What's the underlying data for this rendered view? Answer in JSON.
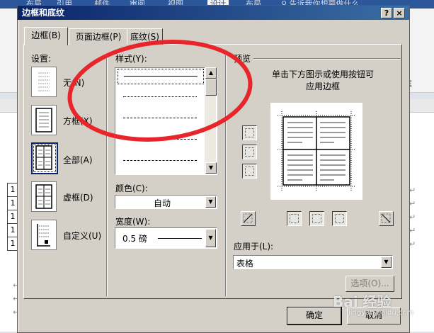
{
  "background": {
    "ribbon_tabs": [
      "布局",
      "引用",
      "邮件",
      "审阅",
      "视图",
      "设计",
      "布局"
    ],
    "tell_me": "告诉我你想要做什么",
    "ribbon_right_label": "框",
    "table_cell_text": "1",
    "para_mark": "↵"
  },
  "dialog": {
    "title": "边框和底纹",
    "help": "?",
    "close": "×",
    "tabs": [
      {
        "label": "边框(B)"
      },
      {
        "label": "页面边框(P)"
      },
      {
        "label": "底纹(S)"
      }
    ],
    "settings": {
      "label": "设置:",
      "items": [
        {
          "label": "无(N)"
        },
        {
          "label": "方框(X)"
        },
        {
          "label": "全部(A)"
        },
        {
          "label": "虚框(D)"
        },
        {
          "label": "自定义(U)"
        }
      ],
      "selected": "全部(A)"
    },
    "style": {
      "label": "样式(Y):",
      "options": [
        "solid",
        "dotted",
        "dashed",
        "long-dash",
        "dash-dot"
      ]
    },
    "color": {
      "label": "颜色(C):",
      "value": "自动"
    },
    "width": {
      "label": "宽度(W):",
      "value": "0.5 磅"
    },
    "preview": {
      "label": "预览",
      "hint_line1": "单击下方图示或使用按钮可",
      "hint_line2": "应用边框"
    },
    "apply_to": {
      "label": "应用于(L):",
      "value": "表格"
    },
    "options_button": "选项(O)...",
    "ok_button": "确定",
    "cancel_button": "取消"
  },
  "watermark": {
    "text": "Bai 经验",
    "sub": "jingyan.baidu.com"
  },
  "colors": {
    "title_start": "#0a246a",
    "title_end": "#3a6ea5",
    "dialog_bg": "#d4d0c8",
    "annotation": "#e8252a",
    "word_blue": "#2b579a"
  }
}
